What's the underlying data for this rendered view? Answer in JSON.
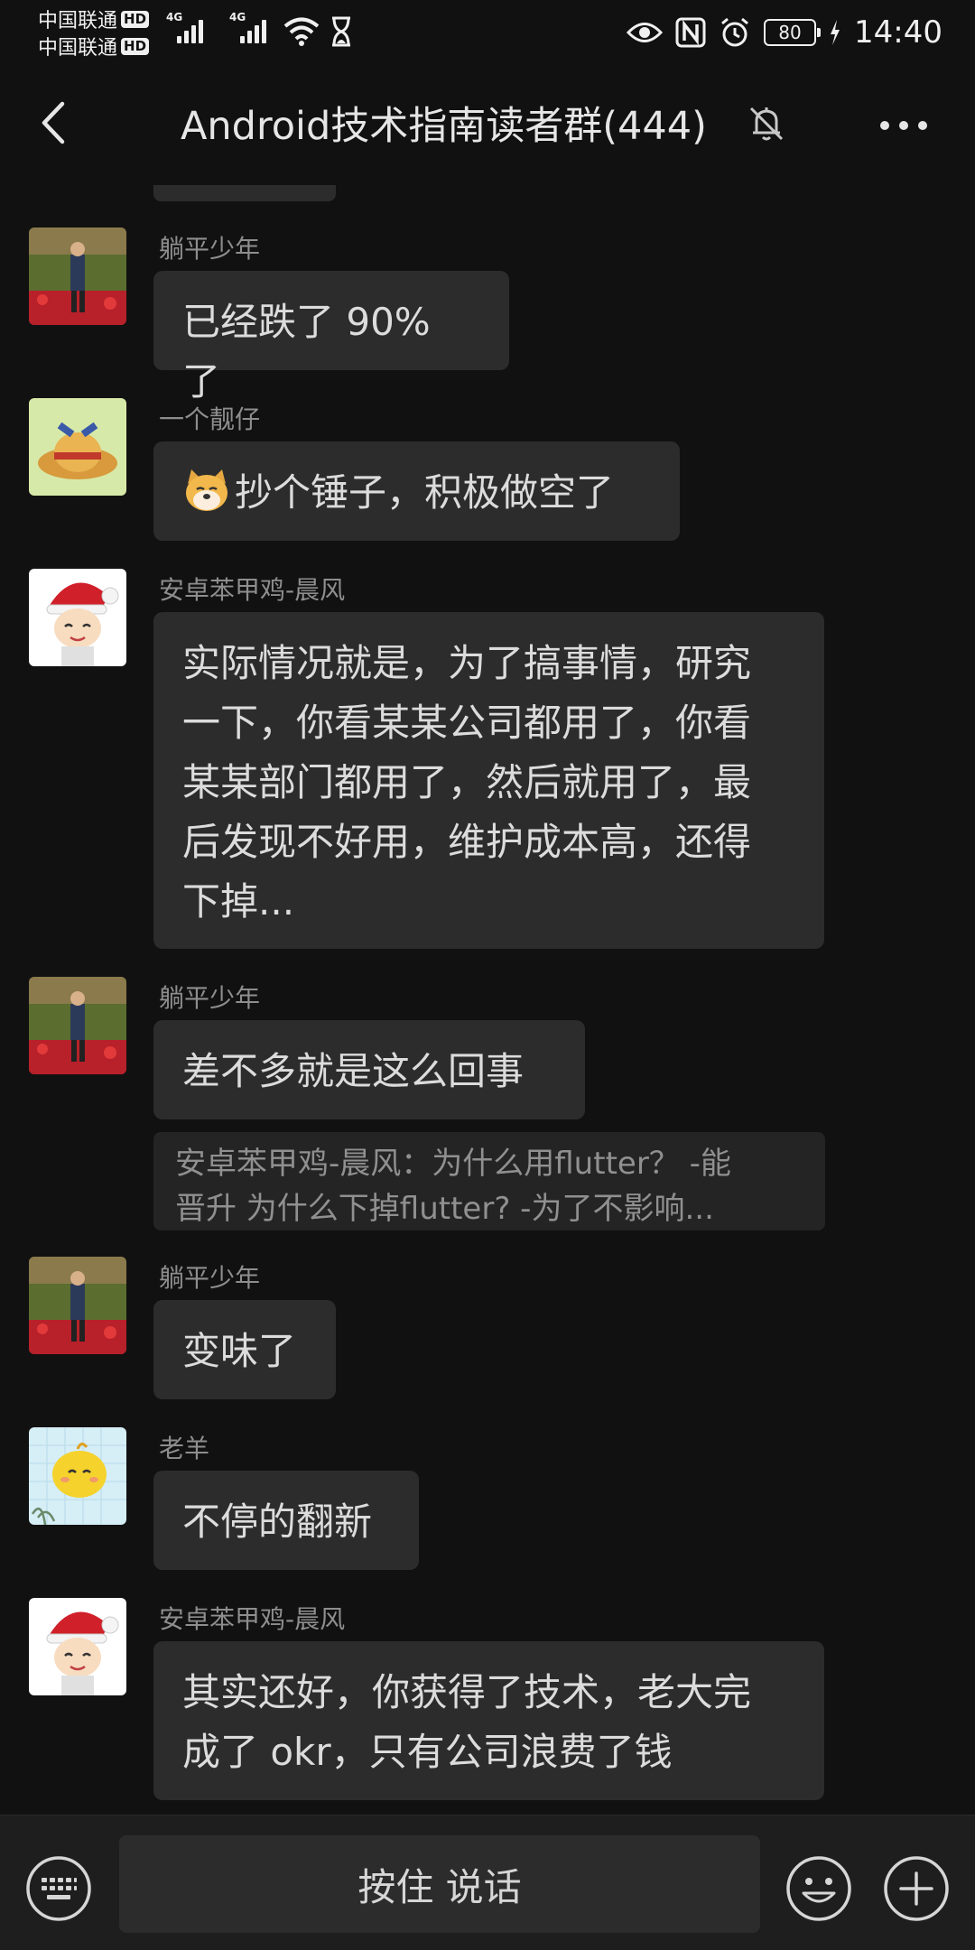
{
  "status_bar": {
    "carrier_1": "中国联通",
    "carrier_2": "中国联通",
    "hd": "HD",
    "network_1": "4G",
    "network_2": "4G",
    "battery": "80",
    "time": "14:40",
    "icons": [
      "eye-icon",
      "nfc-icon",
      "alarm-icon",
      "hourglass-icon",
      "wifi-icon",
      "charging-icon"
    ]
  },
  "header": {
    "title": "Android技术指南读者群(444)",
    "icons": [
      "back-icon",
      "mute-bell-icon",
      "more-icon"
    ]
  },
  "messages": [
    {
      "sender": "躺平少年",
      "lines": [
        "已经跌了 90% 了"
      ]
    },
    {
      "sender": "一个靓仔",
      "lines": [
        "抄个锤子，积极做空了"
      ],
      "emoji": "doge-emoji"
    },
    {
      "sender": "安卓苯甲鸡-晨风",
      "lines": [
        "实际情况就是，为了搞事情，研究",
        "一下，你看某某公司都用了，你看",
        "某某部门都用了，然后就用了，最",
        "后发现不好用，维护成本高，还得",
        "下掉..."
      ]
    },
    {
      "sender": "躺平少年",
      "lines": [
        "差不多就是这么回事"
      ],
      "quote": [
        "安卓苯甲鸡-晨风：为什么用flutter？ -能",
        "晋升  为什么下掉flutter? -为了不影响..."
      ]
    },
    {
      "sender": "躺平少年",
      "lines": [
        "变味了"
      ]
    },
    {
      "sender": "老羊",
      "lines": [
        "不停的翻新"
      ]
    },
    {
      "sender": "安卓苯甲鸡-晨风",
      "lines": [
        "其实还好，你获得了技术，老大完",
        "成了 okr，只有公司浪费了钱"
      ]
    }
  ],
  "input_bar": {
    "hold_to_talk": "按住 说话",
    "icons": [
      "keyboard-icon",
      "emoji-icon",
      "plus-icon"
    ]
  }
}
